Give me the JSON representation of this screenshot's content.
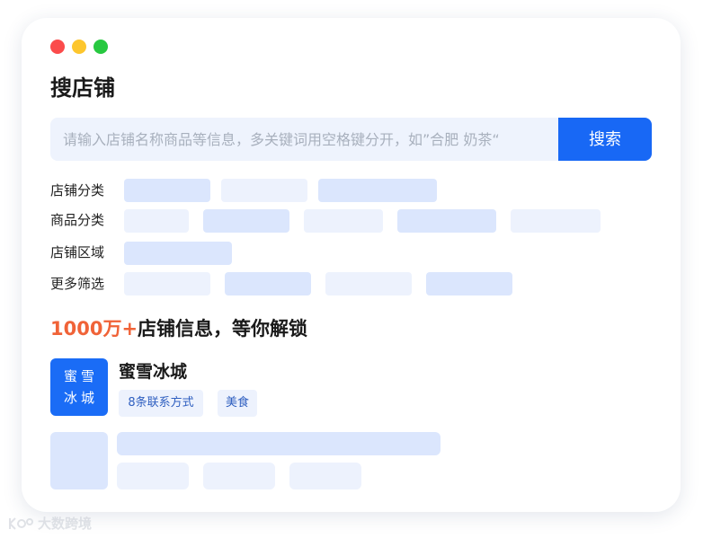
{
  "window": {
    "controls": [
      "close",
      "minimize",
      "maximize"
    ]
  },
  "page": {
    "title": "搜店铺"
  },
  "search": {
    "placeholder": "请输入店铺名称商品等信息，多关键词用空格键分开，如”合肥 奶茶“",
    "button_label": "搜索"
  },
  "filters": {
    "shop_category_label": "店铺分类",
    "product_category_label": "商品分类",
    "shop_region_label": "店铺区域",
    "more_filters_label": "更多筛选"
  },
  "unlock": {
    "highlight": "1000万+",
    "text": "店铺信息，等你解锁"
  },
  "result": {
    "logo_line1": "蜜雪",
    "logo_line2": "冰城",
    "name": "蜜雪冰城",
    "tags": [
      "8条联系方式",
      "美食"
    ]
  },
  "watermark": {
    "text": "大数跨境"
  },
  "colors": {
    "primary": "#1868f5",
    "highlight": "#f06338",
    "skeleton_dark": "#dbe6fd",
    "skeleton_light": "#edf2fd"
  }
}
